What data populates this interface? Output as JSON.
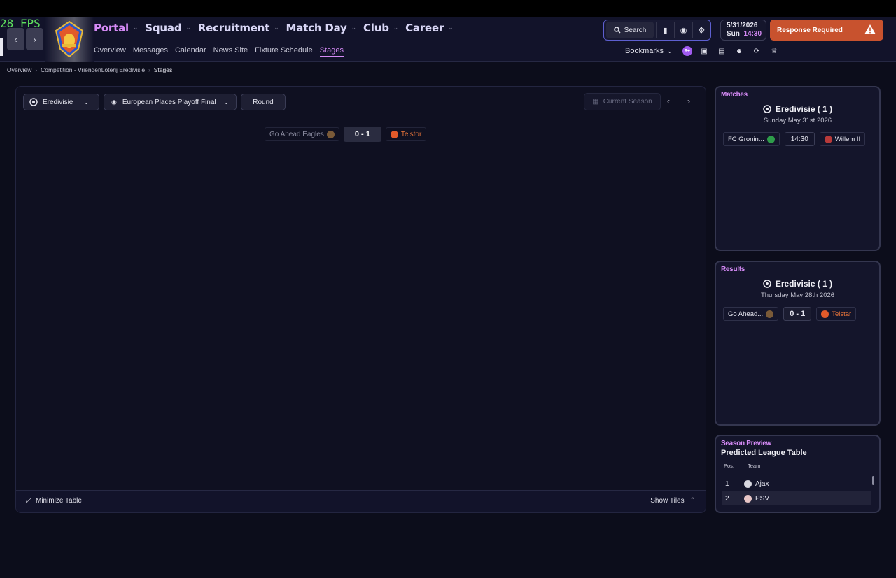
{
  "fps": "28 FPS",
  "nav": {
    "main": [
      {
        "label": "Portal",
        "active": true
      },
      {
        "label": "Squad",
        "active": false
      },
      {
        "label": "Recruitment",
        "active": false
      },
      {
        "label": "Match Day",
        "active": false
      },
      {
        "label": "Club",
        "active": false
      },
      {
        "label": "Career",
        "active": false
      }
    ],
    "sub": [
      {
        "label": "Overview",
        "active": false
      },
      {
        "label": "Messages",
        "active": false
      },
      {
        "label": "Calendar",
        "active": false
      },
      {
        "label": "News Site",
        "active": false
      },
      {
        "label": "Fixture Schedule",
        "active": false
      },
      {
        "label": "Stages",
        "active": true
      }
    ]
  },
  "toolbar": {
    "search_label": "Search"
  },
  "date": {
    "date": "5/31/2026",
    "day": "Sun",
    "time": "14:30"
  },
  "alert": {
    "label": "Response Required"
  },
  "bookmarks": {
    "label": "Bookmarks",
    "badge": "9+"
  },
  "breadcrumb": [
    "Overview",
    "Competition - VriendenLoterij Eredivisie",
    "Stages"
  ],
  "filters": {
    "competition": "Eredivisie",
    "stage": "European Places Playoff Final",
    "round": "Round",
    "season": "Current Season"
  },
  "fixture": {
    "home": "Go Ahead Eagles",
    "score": "0 - 1",
    "away": "Telstor"
  },
  "footer": {
    "minimize": "Minimize Table",
    "tiles": "Show Tiles"
  },
  "matches": {
    "header": "Matches",
    "competition": "Eredivisie  ( 1 )",
    "date": "Sunday May 31st 2026",
    "home": "FC Gronin...",
    "time": "14:30",
    "away": "Willem II"
  },
  "results": {
    "header": "Results",
    "competition": "Eredivisie  ( 1 )",
    "date": "Thursday May 28th 2026",
    "home": "Go Ahead...",
    "score": "0 - 1",
    "away": "Telstar"
  },
  "preview": {
    "header": "Season Preview",
    "title": "Predicted League Table",
    "col_pos": "Pos.",
    "col_team": "Team",
    "rows": [
      {
        "pos": "1",
        "team": "Ajax"
      },
      {
        "pos": "2",
        "team": "PSV"
      }
    ]
  },
  "colors": {
    "accent": "#d58af5",
    "alert": "#c8522e",
    "telstar": "#e8743a"
  }
}
